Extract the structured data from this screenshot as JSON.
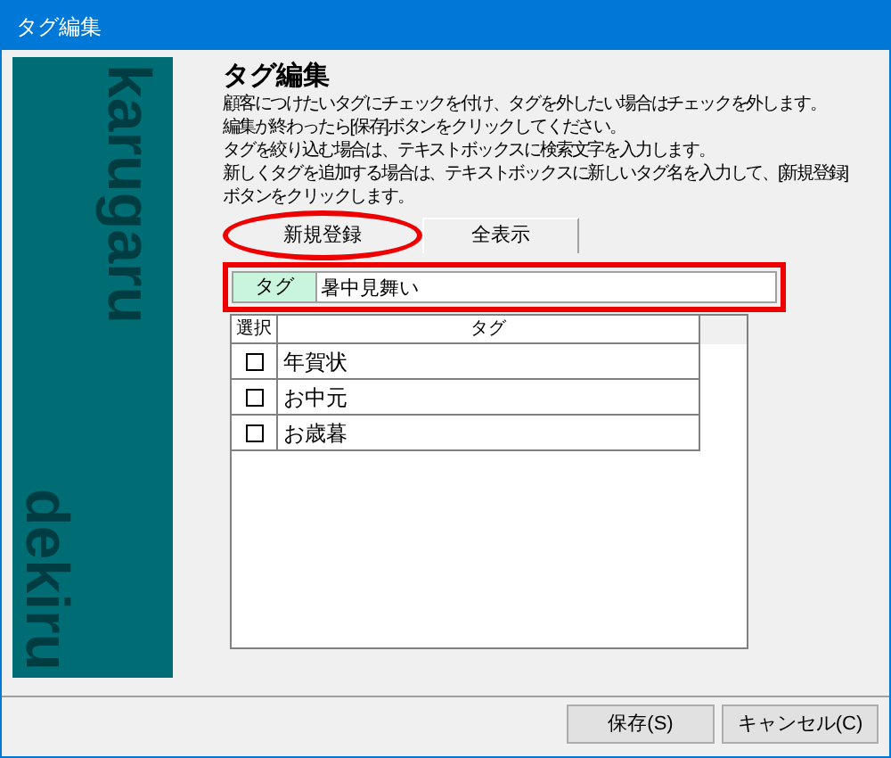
{
  "window": {
    "title": "タグ編集"
  },
  "side_panel": {
    "texts": [
      "karugaru",
      "dekiru"
    ]
  },
  "heading": "タグ編集",
  "description": [
    "顧客につけたいタグにチェックを付け、タグを外したい場合はチェックを外します。",
    "編集が終わったら[保存]ボタンをクリックしてください。",
    "タグを絞り込む場合は、テキストボックスに検索文字を入力します。",
    "新しくタグを追加する場合は、テキストボックスに新しいタグ名を入力して、[新規登録]",
    "ボタンをクリックします。"
  ],
  "toolbar": [
    "新規登録",
    "全表示"
  ],
  "tag_field": {
    "label": "タグ",
    "value": "暑中見舞い"
  },
  "table": {
    "columns": [
      "選択",
      "タグ"
    ],
    "rows": [
      {
        "checked": false,
        "tag": "年賀状"
      },
      {
        "checked": false,
        "tag": "お中元"
      },
      {
        "checked": false,
        "tag": "お歳暮"
      }
    ]
  },
  "buttons": [
    "保存(S)",
    "キャンセル(C)"
  ]
}
